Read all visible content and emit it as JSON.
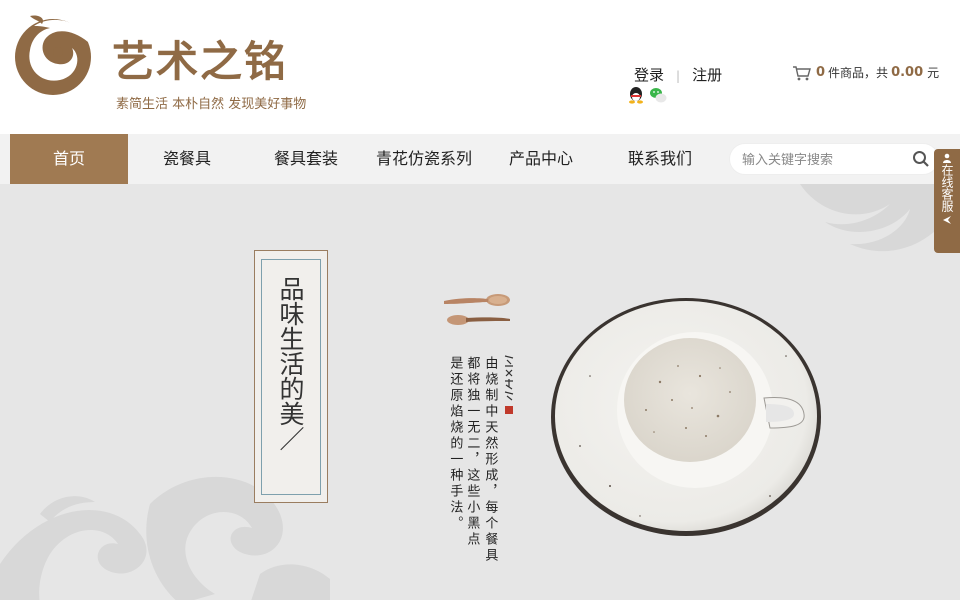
{
  "brand": {
    "name": "艺术之铭",
    "slogan": "素简生活 本朴自然 发现美好事物"
  },
  "auth": {
    "login": "登录",
    "register": "注册"
  },
  "cart": {
    "count": "0",
    "count_suffix": "件商品，共",
    "total": "0.00",
    "currency": "元"
  },
  "nav": {
    "items": [
      "首页",
      "瓷餐具",
      "餐具套装",
      "青花仿瓷系列",
      "产品中心",
      "联系我们"
    ]
  },
  "search": {
    "placeholder": "输入关键字搜索"
  },
  "service": {
    "label": "在线客服"
  },
  "banner": {
    "title": "品味生活的美／",
    "poem_col1": "由烧制中天然形成，每个餐具",
    "poem_col2": "都将独一无二，这些小黑点",
    "poem_col3": "是还原焰烧的一种手法。"
  },
  "colors": {
    "brand": "#8f6a45",
    "nav_active": "#a07a52",
    "banner_bg": "#e6e6e6"
  }
}
